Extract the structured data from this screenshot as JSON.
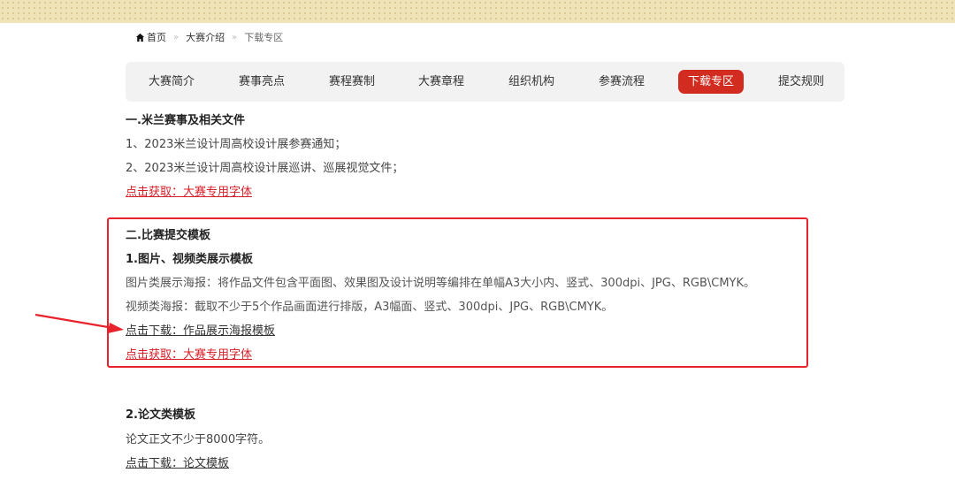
{
  "breadcrumb": {
    "home": "首页",
    "items": [
      "大赛介绍",
      "下载专区"
    ],
    "sep": "»"
  },
  "tabs": [
    {
      "label": "大赛简介"
    },
    {
      "label": "赛事亮点"
    },
    {
      "label": "赛程赛制"
    },
    {
      "label": "大赛章程"
    },
    {
      "label": "组织机构"
    },
    {
      "label": "参赛流程"
    },
    {
      "label": "下载专区",
      "active": true
    },
    {
      "label": "提交规则"
    }
  ],
  "section1": {
    "title": "一.米兰赛事及相关文件",
    "lines": [
      "1、2023米兰设计周高校设计展参赛通知；",
      "2、2023米兰设计周高校设计展巡讲、巡展视觉文件；"
    ],
    "font_link": "点击获取：大赛专用字体"
  },
  "section2": {
    "title": "二.比赛提交模板",
    "subtitle": "1.图片、视频类展示模板",
    "poster_desc": "图片类展示海报：将作品文件包含平面图、效果图及设计说明等编排在单幅A3大小内、竖式、300dpi、JPG、RGB\\CMYK。",
    "video_desc": "视频类海报：截取不少于5个作品画面进行排版，A3幅面、竖式、300dpi、JPG、RGB\\CMYK。",
    "download_link": "点击下载：作品展示海报模板",
    "font_link": "点击获取：大赛专用字体"
  },
  "section3": {
    "title": "2.论文类模板",
    "desc": "论文正文不少于8000字符。",
    "download_link": "点击下载：论文模板"
  },
  "colors": {
    "accent_red": "#d22b1f",
    "link_red": "#d8202a",
    "highlight_border": "#e8232c",
    "top_band": "#efe3b8"
  }
}
